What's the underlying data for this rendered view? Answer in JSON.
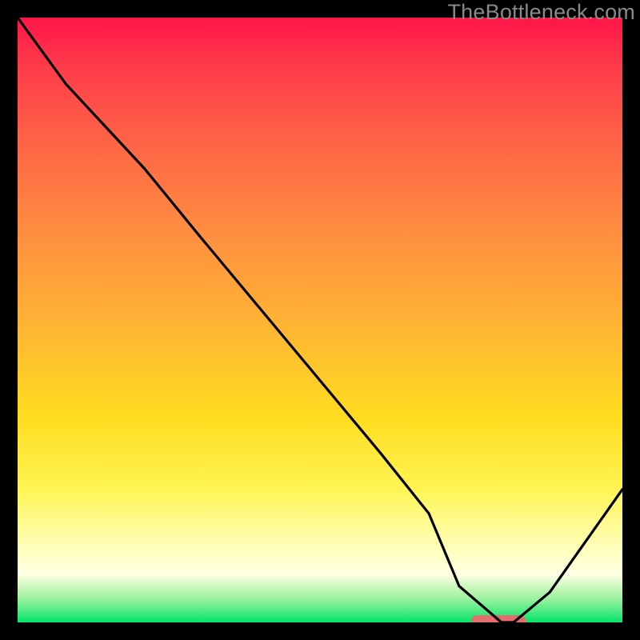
{
  "watermark": "TheBottleneck.com",
  "chart_data": {
    "type": "line",
    "title": "",
    "xlabel": "",
    "ylabel": "",
    "xlim": [
      0,
      100
    ],
    "ylim": [
      0,
      100
    ],
    "grid": false,
    "legend": false,
    "marker": {
      "x_range": [
        75,
        84
      ],
      "y": 0,
      "color": "#e36e6d"
    },
    "series": [
      {
        "name": "curve",
        "x": [
          0,
          8,
          21,
          30,
          40,
          50,
          60,
          68,
          73,
          80,
          82,
          88,
          100
        ],
        "y": [
          100,
          89,
          75,
          64,
          52,
          40,
          28,
          18,
          6,
          0,
          0,
          5,
          22
        ]
      }
    ],
    "background_gradient": {
      "type": "vertical",
      "stops": [
        {
          "pos": 0.0,
          "color": "#ff1548"
        },
        {
          "pos": 0.08,
          "color": "#ff3b4a"
        },
        {
          "pos": 0.22,
          "color": "#ff6846"
        },
        {
          "pos": 0.36,
          "color": "#ff8f40"
        },
        {
          "pos": 0.52,
          "color": "#ffb733"
        },
        {
          "pos": 0.66,
          "color": "#ffdc1f"
        },
        {
          "pos": 0.78,
          "color": "#fff454"
        },
        {
          "pos": 0.88,
          "color": "#ffffbd"
        },
        {
          "pos": 0.92,
          "color": "#ffffe3"
        },
        {
          "pos": 0.96,
          "color": "#9ff2a0"
        },
        {
          "pos": 1.0,
          "color": "#04e36b"
        }
      ]
    }
  }
}
